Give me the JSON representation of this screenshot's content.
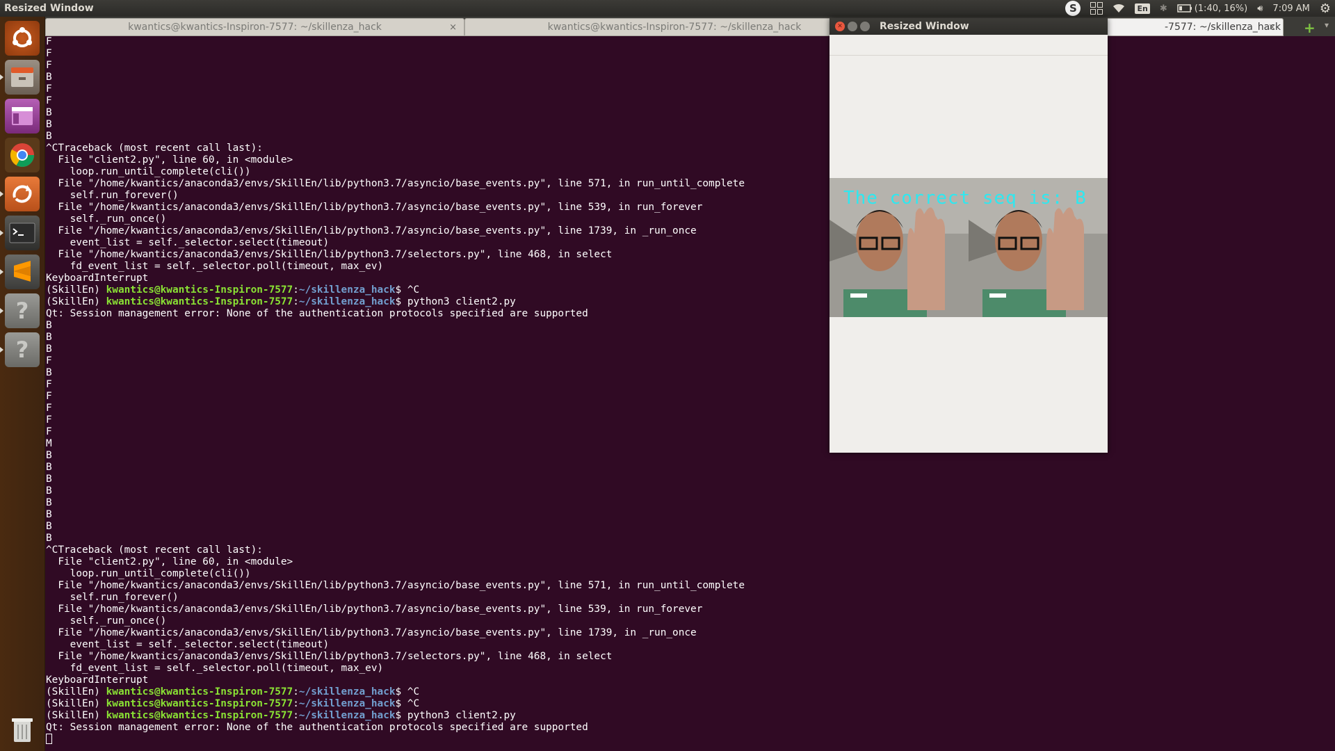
{
  "top_panel": {
    "title": "Resized Window",
    "keyboard": "En",
    "battery": "(1:40, 16%)",
    "time": "7:09 AM"
  },
  "launcher": {
    "items": [
      "ubuntu-dash",
      "files",
      "app-purple",
      "chrome",
      "software-updater",
      "terminal",
      "sublime-text",
      "unknown-app",
      "unknown-app",
      "trash"
    ]
  },
  "tabs": [
    {
      "label": "kwantics@kwantics-Inspiron-7577: ~/skillenza_hack",
      "close": "×"
    },
    {
      "label": "kwantics@kwantics-Inspiron-7577: ~/skillenza_hack",
      "close": ""
    },
    {
      "label": "-7577: ~/skillenza_hack",
      "close": "×"
    }
  ],
  "resized_window": {
    "title": "Resized Window",
    "overlay_text": "The correct seq is: B"
  },
  "terminal": {
    "lines": [
      {
        "text": "F"
      },
      {
        "text": "F"
      },
      {
        "text": "F"
      },
      {
        "text": "B"
      },
      {
        "text": "F"
      },
      {
        "text": "F"
      },
      {
        "text": "B"
      },
      {
        "text": "B"
      },
      {
        "text": "B"
      },
      {
        "text": "^CTraceback (most recent call last):"
      },
      {
        "text": "  File \"client2.py\", line 60, in <module>"
      },
      {
        "text": "    loop.run_until_complete(cli())"
      },
      {
        "text": "  File \"/home/kwantics/anaconda3/envs/SkillEn/lib/python3.7/asyncio/base_events.py\", line 571, in run_until_complete"
      },
      {
        "text": "    self.run_forever()"
      },
      {
        "text": "  File \"/home/kwantics/anaconda3/envs/SkillEn/lib/python3.7/asyncio/base_events.py\", line 539, in run_forever"
      },
      {
        "text": "    self._run_once()"
      },
      {
        "text": "  File \"/home/kwantics/anaconda3/envs/SkillEn/lib/python3.7/asyncio/base_events.py\", line 1739, in _run_once"
      },
      {
        "text": "    event_list = self._selector.select(timeout)"
      },
      {
        "text": "  File \"/home/kwantics/anaconda3/envs/SkillEn/lib/python3.7/selectors.py\", line 468, in select"
      },
      {
        "text": "    fd_event_list = self._selector.poll(timeout, max_ev)"
      },
      {
        "text": "KeyboardInterrupt"
      },
      {
        "prompt": true,
        "env": "(SkillEn) ",
        "user": "kwantics@kwantics-Inspiron-7577",
        "path": "~/skillenza_hack",
        "cmd": "$ ^C"
      },
      {
        "prompt": true,
        "env": "(SkillEn) ",
        "user": "kwantics@kwantics-Inspiron-7577",
        "path": "~/skillenza_hack",
        "cmd": "$ python3 client2.py"
      },
      {
        "text": "Qt: Session management error: None of the authentication protocols specified are supported"
      },
      {
        "text": "B"
      },
      {
        "text": "B"
      },
      {
        "text": "B"
      },
      {
        "text": "F"
      },
      {
        "text": "B"
      },
      {
        "text": "F"
      },
      {
        "text": "F"
      },
      {
        "text": "F"
      },
      {
        "text": "F"
      },
      {
        "text": "F"
      },
      {
        "text": "M"
      },
      {
        "text": "B"
      },
      {
        "text": "B"
      },
      {
        "text": "B"
      },
      {
        "text": "B"
      },
      {
        "text": "B"
      },
      {
        "text": "B"
      },
      {
        "text": "B"
      },
      {
        "text": "B"
      },
      {
        "text": "^CTraceback (most recent call last):"
      },
      {
        "text": "  File \"client2.py\", line 60, in <module>"
      },
      {
        "text": "    loop.run_until_complete(cli())"
      },
      {
        "text": "  File \"/home/kwantics/anaconda3/envs/SkillEn/lib/python3.7/asyncio/base_events.py\", line 571, in run_until_complete"
      },
      {
        "text": "    self.run_forever()"
      },
      {
        "text": "  File \"/home/kwantics/anaconda3/envs/SkillEn/lib/python3.7/asyncio/base_events.py\", line 539, in run_forever"
      },
      {
        "text": "    self._run_once()"
      },
      {
        "text": "  File \"/home/kwantics/anaconda3/envs/SkillEn/lib/python3.7/asyncio/base_events.py\", line 1739, in _run_once"
      },
      {
        "text": "    event_list = self._selector.select(timeout)"
      },
      {
        "text": "  File \"/home/kwantics/anaconda3/envs/SkillEn/lib/python3.7/selectors.py\", line 468, in select"
      },
      {
        "text": "    fd_event_list = self._selector.poll(timeout, max_ev)"
      },
      {
        "text": "KeyboardInterrupt"
      },
      {
        "prompt": true,
        "env": "(SkillEn) ",
        "user": "kwantics@kwantics-Inspiron-7577",
        "path": "~/skillenza_hack",
        "cmd": "$ ^C"
      },
      {
        "prompt": true,
        "env": "(SkillEn) ",
        "user": "kwantics@kwantics-Inspiron-7577",
        "path": "~/skillenza_hack",
        "cmd": "$ ^C"
      },
      {
        "prompt": true,
        "env": "(SkillEn) ",
        "user": "kwantics@kwantics-Inspiron-7577",
        "path": "~/skillenza_hack",
        "cmd": "$ python3 client2.py"
      },
      {
        "text": "Qt: Session management error: None of the authentication protocols specified are supported"
      },
      {
        "cursor": true
      }
    ]
  }
}
